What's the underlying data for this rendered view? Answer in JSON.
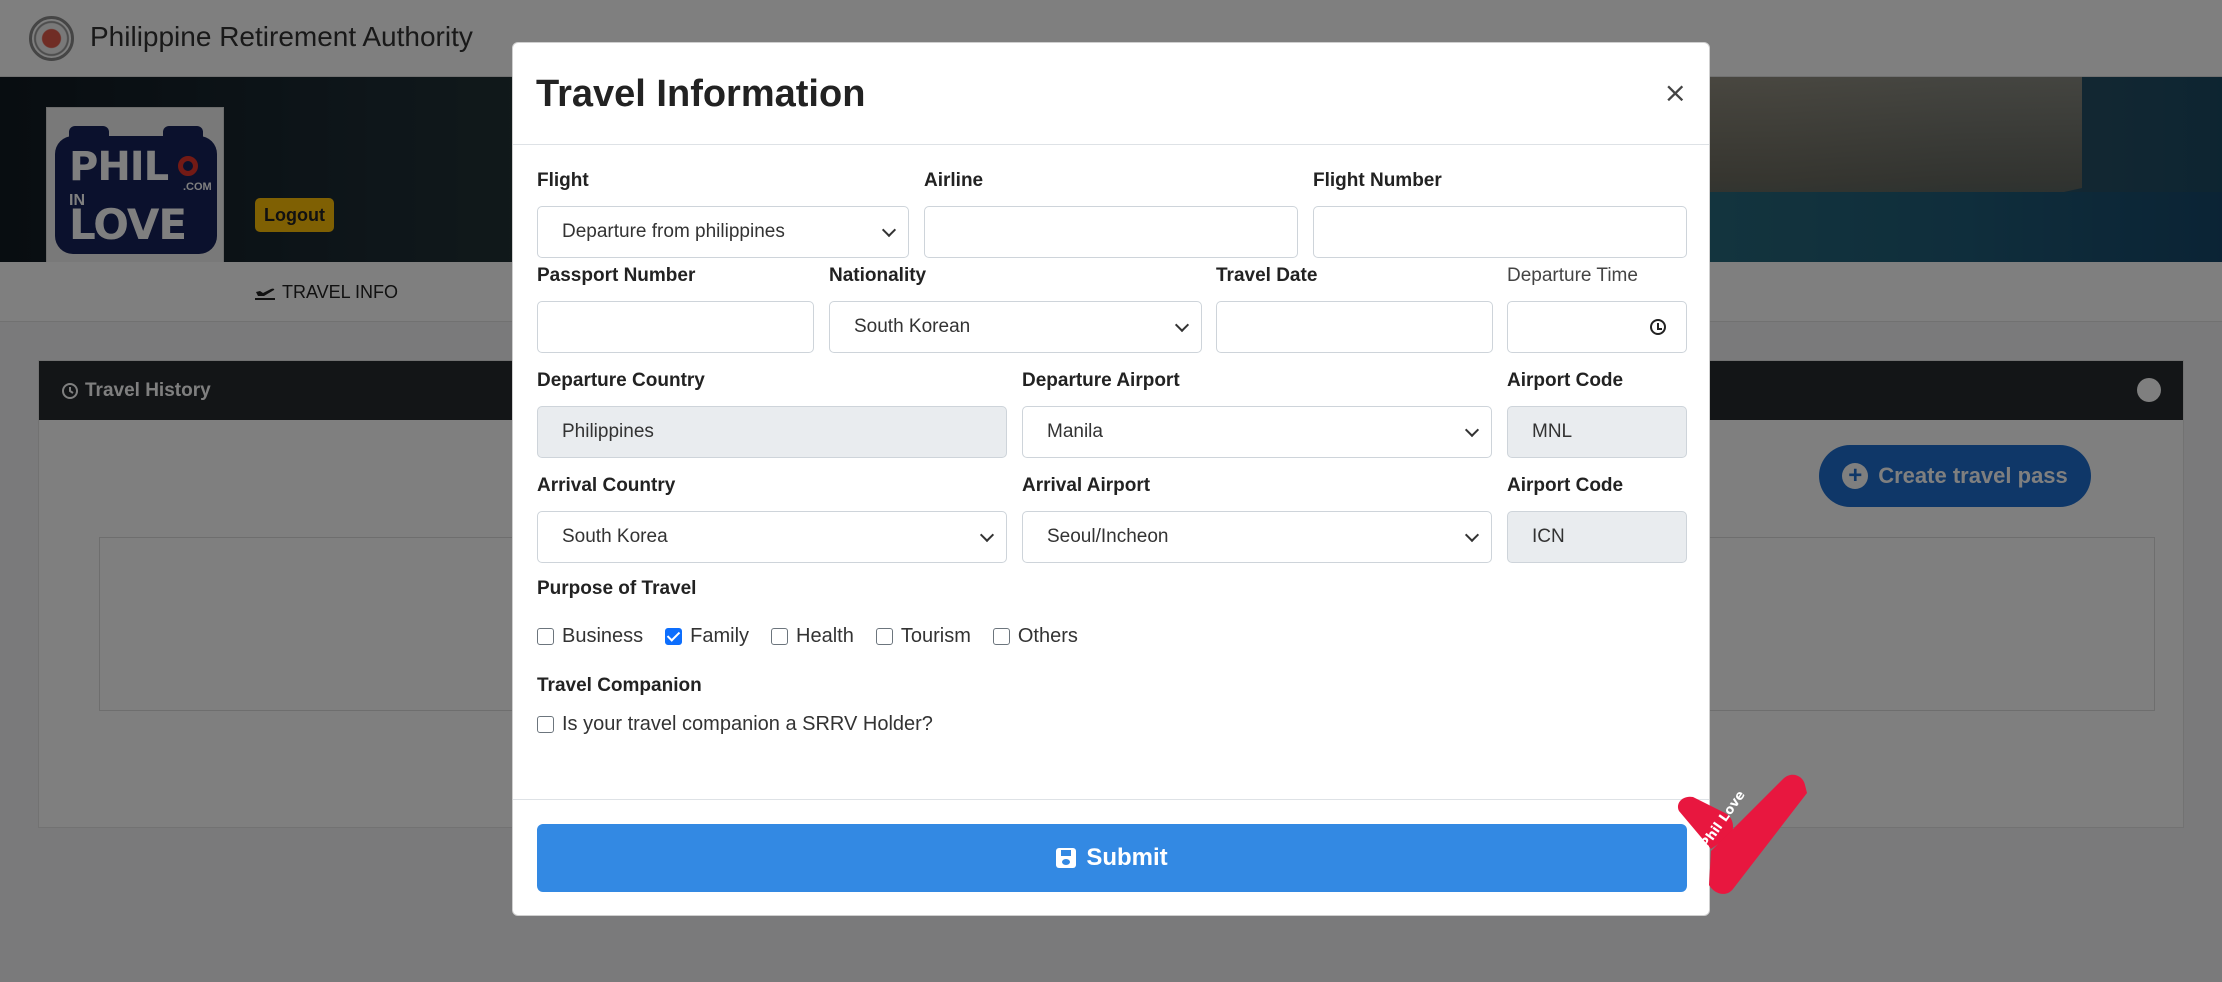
{
  "page": {
    "brand_name": "Philippine Retirement Authority",
    "logout_label": "Logout",
    "tab_label": "TRAVEL INFO",
    "card_title": "Travel History",
    "create_button_label": "Create travel pass",
    "logo": {
      "line1": "PHIL",
      "suffix": ".COM",
      "line_in": "IN",
      "line2": "LOVE"
    }
  },
  "modal": {
    "title": "Travel Information",
    "close_glyph": "×",
    "fields": {
      "flight": {
        "label": "Flight",
        "value": "Departure from philippines"
      },
      "airline": {
        "label": "Airline",
        "value": ""
      },
      "flight_number": {
        "label": "Flight Number",
        "value": ""
      },
      "passport_number": {
        "label": "Passport Number",
        "value": ""
      },
      "nationality": {
        "label": "Nationality",
        "value": "South Korean"
      },
      "travel_date": {
        "label": "Travel Date",
        "value": ""
      },
      "departure_time": {
        "label": "Departure Time",
        "value": ""
      },
      "departure_country": {
        "label": "Departure Country",
        "value": "Philippines"
      },
      "departure_airport": {
        "label": "Departure Airport",
        "value": "Manila"
      },
      "departure_airport_code": {
        "label": "Airport Code",
        "value": "MNL"
      },
      "arrival_country": {
        "label": "Arrival Country",
        "value": "South Korea"
      },
      "arrival_airport": {
        "label": "Arrival Airport",
        "value": "Seoul/Incheon"
      },
      "arrival_airport_code": {
        "label": "Airport Code",
        "value": "ICN"
      }
    },
    "purpose": {
      "label": "Purpose of Travel",
      "options": [
        {
          "label": "Business",
          "checked": false
        },
        {
          "label": "Family",
          "checked": true
        },
        {
          "label": "Health",
          "checked": false
        },
        {
          "label": "Tourism",
          "checked": false
        },
        {
          "label": "Others",
          "checked": false
        }
      ]
    },
    "companion": {
      "label": "Travel Companion",
      "question": "Is your travel companion a SRRV Holder?",
      "checked": false
    },
    "submit_label": "Submit",
    "watermark_text": "Phil Love"
  },
  "colors": {
    "primary": "#3389e3",
    "create_button": "#1f6fd0",
    "logout": "#ffc107",
    "checkbox_checked": "#0d6efd",
    "watermark": "#e8173f"
  }
}
